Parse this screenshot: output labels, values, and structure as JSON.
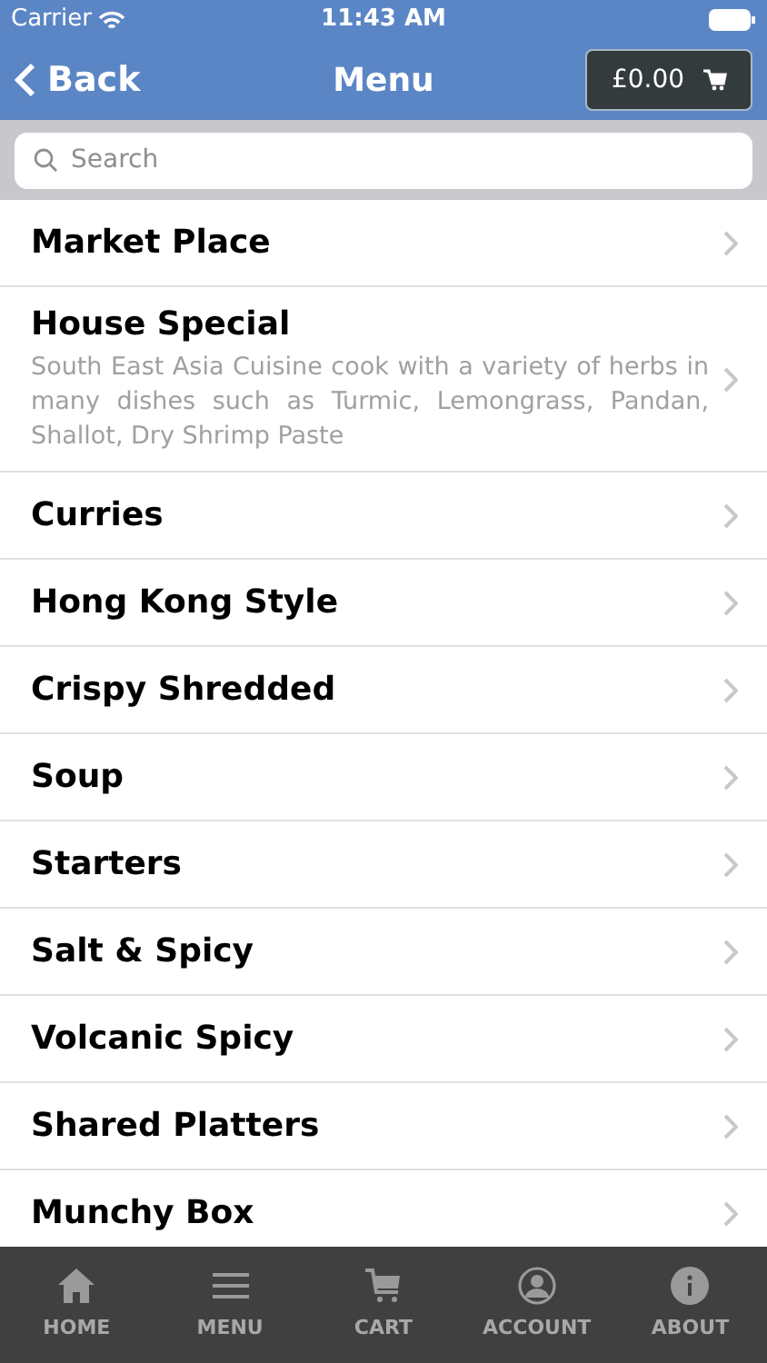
{
  "status_bar": {
    "carrier": "Carrier",
    "time": "11:43 AM"
  },
  "nav": {
    "back": "Back",
    "title": "Menu",
    "cart_total": "£0.00"
  },
  "search": {
    "placeholder": "Search"
  },
  "categories": [
    {
      "title": "Market Place"
    },
    {
      "title": "House Special",
      "description": "South East Asia Cuisine cook with a variety of herbs in many dishes such as Turmic, Lemongrass, Pandan, Shallot, Dry Shrimp Paste"
    },
    {
      "title": "Curries"
    },
    {
      "title": "Hong Kong Style"
    },
    {
      "title": "Crispy Shredded"
    },
    {
      "title": "Soup"
    },
    {
      "title": "Starters"
    },
    {
      "title": "Salt & Spicy"
    },
    {
      "title": "Volcanic Spicy"
    },
    {
      "title": "Shared Platters"
    },
    {
      "title": "Munchy Box"
    }
  ],
  "tab_bar": [
    {
      "kind": "home",
      "label": "HOME"
    },
    {
      "kind": "menu",
      "label": "MENU"
    },
    {
      "kind": "cart",
      "label": "CART"
    },
    {
      "kind": "account",
      "label": "ACCOUNT"
    },
    {
      "kind": "about",
      "label": "ABOUT"
    }
  ]
}
